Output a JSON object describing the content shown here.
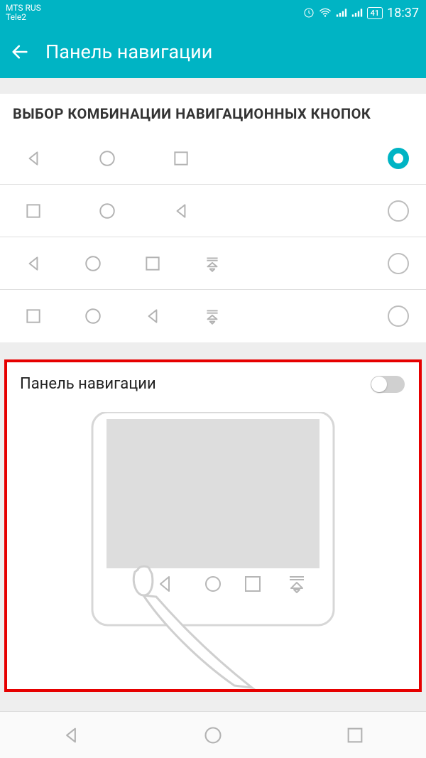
{
  "status": {
    "carrier1": "MTS RUS",
    "carrier2": "Tele2",
    "battery": "41",
    "time": "18:37"
  },
  "appbar": {
    "title": "Панель навигации"
  },
  "section": {
    "header": "ВЫБОР КОМБИНАЦИИ НАВИГАЦИОННЫХ КНОПОК"
  },
  "combos": [
    {
      "icons": [
        "back",
        "home",
        "recent"
      ],
      "selected": true
    },
    {
      "icons": [
        "recent",
        "home",
        "back"
      ],
      "selected": false
    },
    {
      "icons": [
        "back",
        "home",
        "recent",
        "collapse"
      ],
      "selected": false
    },
    {
      "icons": [
        "recent",
        "home",
        "back",
        "collapse"
      ],
      "selected": false
    }
  ],
  "panel": {
    "label": "Панель навигации",
    "enabled": false
  },
  "colors": {
    "accent": "#00b4c4",
    "highlight": "#e60000"
  }
}
